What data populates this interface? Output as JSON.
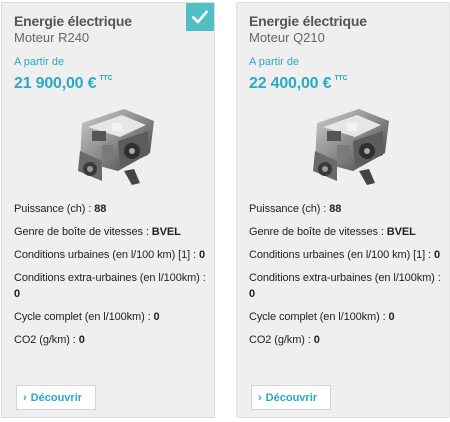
{
  "cards": [
    {
      "energy": "Energie électrique",
      "motor": "Moteur R240",
      "from_label": "A partir de",
      "price": "21 900,00 €",
      "price_suffix": "TTC",
      "selected": true,
      "check_icon": "checkmark-icon",
      "specs": [
        {
          "label": "Puissance (ch) : ",
          "value": "88"
        },
        {
          "label": "Genre de boîte de vitesses : ",
          "value": "BVEL"
        },
        {
          "label": "Conditions urbaines (en l/100 km) [1] : ",
          "value": "0"
        },
        {
          "label": "Conditions extra-urbaines (en l/100km) : ",
          "value": "0"
        },
        {
          "label": "Cycle complet (en l/100km) : ",
          "value": "0"
        },
        {
          "label": "CO2 (g/km) : ",
          "value": "0"
        }
      ],
      "button_label": "Découvrir",
      "button_icon": "chevron-right-icon"
    },
    {
      "energy": "Energie électrique",
      "motor": "Moteur Q210",
      "from_label": "A partir de",
      "price": "22 400,00 €",
      "price_suffix": "TTC",
      "selected": false,
      "specs": [
        {
          "label": "Puissance (ch) : ",
          "value": "88"
        },
        {
          "label": "Genre de boîte de vitesses : ",
          "value": "BVEL"
        },
        {
          "label": "Conditions urbaines (en l/100 km) [1] : ",
          "value": "0"
        },
        {
          "label": "Conditions extra-urbaines (en l/100km) : ",
          "value": "0"
        },
        {
          "label": "Cycle complet (en l/100km) : ",
          "value": "0"
        },
        {
          "label": "CO2 (g/km) : ",
          "value": "0"
        }
      ],
      "button_label": "Découvrir",
      "button_icon": "chevron-right-icon"
    }
  ],
  "colors": {
    "accent": "#2aa9c8",
    "check_bg": "#4fbfc4",
    "card_bg": "#efefef"
  }
}
